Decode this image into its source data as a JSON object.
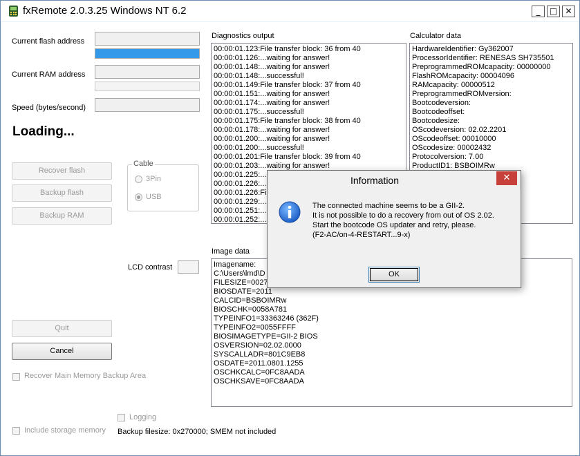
{
  "window": {
    "title": "fxRemote 2.0.3.25 Windows NT 6.2",
    "minimize_glyph": "_",
    "maximize_glyph": "□",
    "close_glyph": "✕"
  },
  "left": {
    "flash_label": "Current flash address",
    "ram_label": "Current RAM address",
    "speed_label": "Speed (bytes/second)",
    "flash_progress": 1.0,
    "status_text": "Loading...",
    "recover_flash_label": "Recover flash",
    "backup_flash_label": "Backup flash",
    "backup_ram_label": "Backup RAM",
    "cable_label": "Cable",
    "cable_3pin": "3Pin",
    "cable_usb": "USB",
    "cable_selected": "USB",
    "lcd_contrast_label": "LCD contrast",
    "quit_label": "Quit",
    "cancel_label": "Cancel",
    "recover_main_memory_label": "Recover Main Memory Backup Area",
    "include_storage_label": "Include storage memory",
    "logging_label": "Logging",
    "backup_status": "Backup filesize: 0x270000; SMEM not included"
  },
  "diagnostics": {
    "title": "Diagnostics output",
    "lines": [
      "00:00:01.123:File transfer block: 36 from 40",
      "00:00:01.126:...waiting for answer!",
      "00:00:01.148:...waiting for answer!",
      "00:00:01.148:...successful!",
      "00:00:01.149:File transfer block: 37 from 40",
      "00:00:01.151:...waiting for answer!",
      "00:00:01.174:...waiting for answer!",
      "00:00:01.175:...successful!",
      "00:00:01.175:File transfer block: 38 from 40",
      "00:00:01.178:...waiting for answer!",
      "00:00:01.200:...waiting for answer!",
      "00:00:01.200:...successful!",
      "00:00:01.201:File transfer block: 39 from 40",
      "00:00:01.203:...waiting for answer!",
      "00:00:01.225:...",
      "00:00:01.226:...",
      "00:00:01.226:Fil",
      "00:00:01.229:...",
      "00:00:01.251:...",
      "00:00:01.252:..."
    ]
  },
  "calculator": {
    "title": "Calculator data",
    "lines": [
      "HardwareIdentifier: Gy362007",
      "ProcessorIdentifier: RENESAS SH735501",
      "PreprogrammedROMcapacity: 00000000",
      "FlashROMcapacity: 00004096",
      "RAMcapacity: 00000512",
      "PreprogrammedROMversion:",
      "Bootcodeversion:",
      "Bootcodeoffset:",
      "Bootcodesize:",
      "OScodeversion: 02.02.2201",
      "OScodeoffset: 00010000",
      "OScodesize: 00002432",
      "Protocolversion: 7.00",
      "ProductID1: BSBOIMRw"
    ]
  },
  "image_data": {
    "title": "Image data",
    "lines": [
      "Imagename:",
      "C:\\Users\\lmd\\D",
      "FILESIZE=0027",
      "BIOSDATE=2011",
      "CALCID=BSBOIMRw",
      "BIOSCHK=0058A781",
      "TYPEINFO1=33363246 (362F)",
      "TYPEINFO2=0055FFFF",
      "BIOSIMAGETYPE=GII-2 BIOS",
      "OSVERSION=02.02.0000",
      "SYSCALLADR=801C9EB8",
      "OSDATE=2011.0801.1255",
      "OSCHKCALC=0FC8AADA",
      "OSCHKSAVE=0FC8AADA"
    ]
  },
  "dialog": {
    "title": "Information",
    "close_glyph": "✕",
    "message_lines": [
      "The connected machine seems to be a GII-2.",
      "It is not possible to do a recovery from out of OS 2.02.",
      "Start the bootcode OS updater and retry, please.",
      "(F2-AC/on-4-RESTART...9-x)"
    ],
    "ok_label": "OK",
    "icon": "info-icon"
  }
}
